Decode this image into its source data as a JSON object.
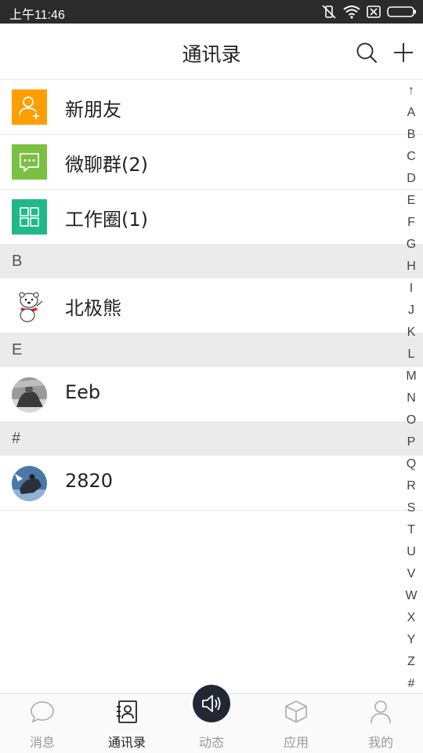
{
  "status_bar": {
    "time": "上午11:46"
  },
  "header": {
    "title": "通讯录"
  },
  "colors": {
    "new_friend": "#ff9e00",
    "group_chat": "#7ac142",
    "work_circle": "#1fb987",
    "section_bg": "#ebebeb",
    "center_tab": "#222833"
  },
  "list": {
    "entries": [
      {
        "label": "新朋友",
        "icon": "new-friend-icon"
      },
      {
        "label": "微聊群(2)",
        "icon": "group-chat-icon"
      },
      {
        "label": "工作圈(1)",
        "icon": "work-circle-icon"
      }
    ],
    "sections": [
      {
        "letter": "B",
        "contacts": [
          {
            "name": "北极熊",
            "avatar": "polar-bear-avatar"
          }
        ]
      },
      {
        "letter": "E",
        "contacts": [
          {
            "name": "Eeb",
            "avatar": "photo-avatar"
          }
        ]
      },
      {
        "letter": "#",
        "contacts": [
          {
            "name": "2820",
            "avatar": "photo-avatar"
          }
        ]
      }
    ]
  },
  "index_bar": [
    "↑",
    "A",
    "B",
    "C",
    "D",
    "E",
    "F",
    "G",
    "H",
    "I",
    "J",
    "K",
    "L",
    "M",
    "N",
    "O",
    "P",
    "Q",
    "R",
    "S",
    "T",
    "U",
    "V",
    "W",
    "X",
    "Y",
    "Z",
    "#"
  ],
  "bottom_nav": {
    "tabs": [
      {
        "label": "消息",
        "icon": "chat-bubble-icon"
      },
      {
        "label": "通讯录",
        "icon": "contacts-book-icon",
        "active": true
      },
      {
        "label": "动态",
        "icon": "speaker-icon"
      },
      {
        "label": "应用",
        "icon": "cube-icon"
      },
      {
        "label": "我的",
        "icon": "person-icon"
      }
    ]
  }
}
